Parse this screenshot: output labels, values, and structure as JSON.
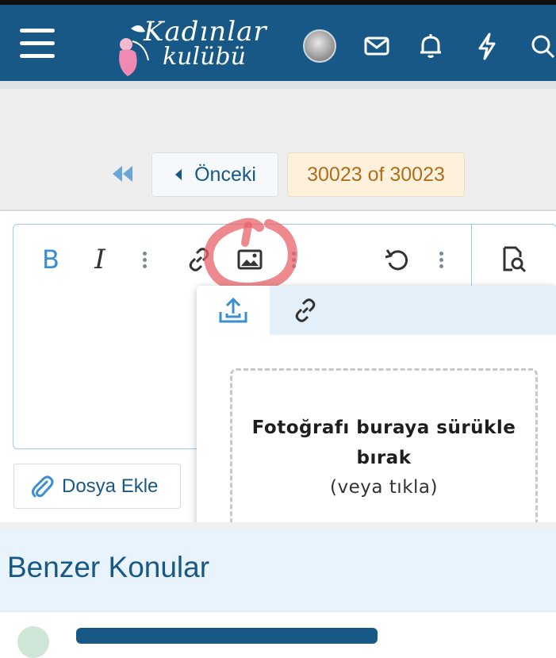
{
  "header": {
    "brand_line1": "Kadınlar",
    "brand_line2": "kulübü",
    "icons": [
      "menu-icon",
      "avatar",
      "mail-icon",
      "bell-icon",
      "lightning-icon",
      "search-icon"
    ]
  },
  "pagination": {
    "prev_label": "Önceki",
    "page_label": "30023 of 30023"
  },
  "editor": {
    "toolbar": {
      "bold_label": "B",
      "italic_label": "I",
      "icons": [
        "more-vertical-icon",
        "link-icon",
        "image-icon",
        "more-vertical-icon",
        "undo-icon",
        "more-vertical-icon",
        "preview-icon"
      ]
    }
  },
  "image_popup": {
    "tabs": [
      "upload-icon",
      "link-icon"
    ],
    "drop_title": "Fotoğrafı buraya sürükle bırak",
    "drop_sub": "(veya tıkla)"
  },
  "attach": {
    "label": "Dosya Ekle"
  },
  "similar": {
    "title": "Benzer Konular"
  },
  "colors": {
    "brand": "#185886",
    "accent": "#3a8fd0",
    "page_badge_bg": "#fdf1dc",
    "page_badge_text": "#b06e1d",
    "annotation": "#e8636a"
  }
}
